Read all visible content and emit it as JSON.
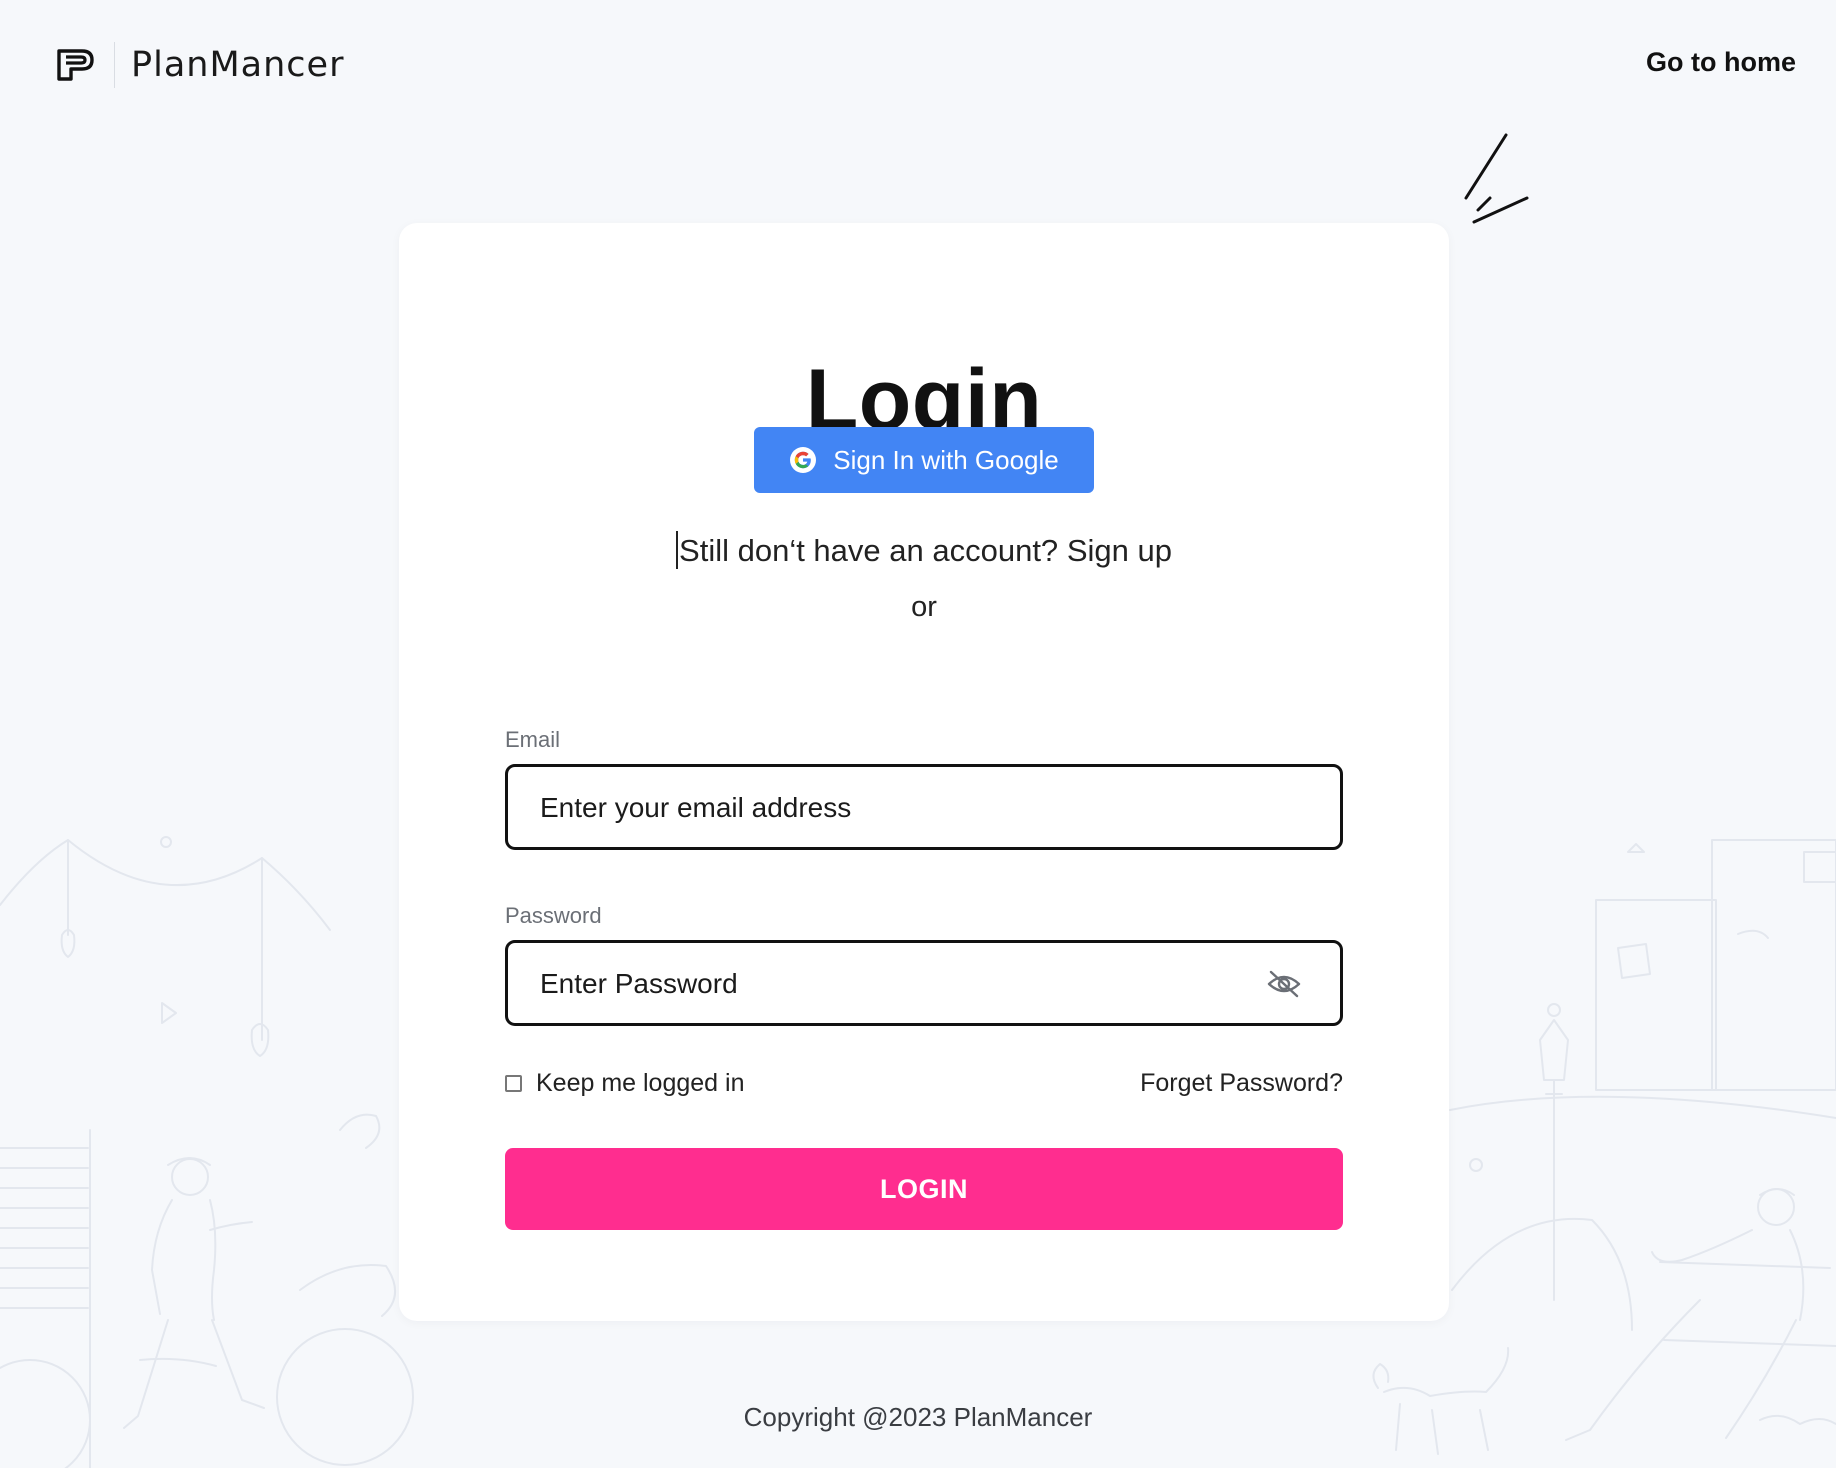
{
  "header": {
    "brand_name": "PlanMancer",
    "go_home_label": "Go to home"
  },
  "login": {
    "title": "Login",
    "google_button_label": "Sign In with Google",
    "signup_prompt": "Still don‘t have an account?",
    "signup_link": "Sign up",
    "or_text": "or",
    "email": {
      "label": "Email",
      "placeholder": "Enter your email address",
      "value": ""
    },
    "password": {
      "label": "Password",
      "placeholder": "Enter Password",
      "value": ""
    },
    "keep_logged_in_label": "Keep me logged in",
    "keep_logged_in_checked": false,
    "forgot_password_label": "Forget Password?",
    "submit_label": "LOGIN"
  },
  "footer": {
    "copyright": "Copyright @2023 PlanMancer"
  },
  "icons": {
    "brand": "planmancer-logo-icon",
    "google": "google-g-icon",
    "password_visibility": "eye-slash-icon"
  },
  "colors": {
    "page_background": "#f6f8fb",
    "card_background": "#ffffff",
    "google_button": "#4285f4",
    "login_button": "#ff2d8f",
    "text_primary": "#111111",
    "label_text": "#6b6f76"
  }
}
